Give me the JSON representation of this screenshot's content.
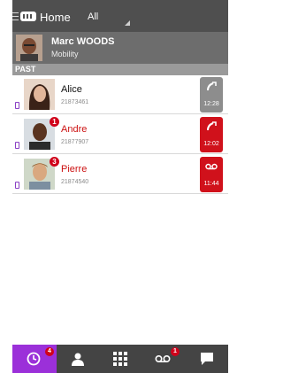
{
  "header": {
    "title": "Home",
    "filter": "All"
  },
  "profile": {
    "name": "Marc WOODS",
    "status": "Mobility"
  },
  "section": {
    "label": "PAST"
  },
  "calls": [
    {
      "name": "Alice",
      "number": "21873461",
      "time": "12:28",
      "missed": false,
      "badge": "",
      "type": "outgoing-call"
    },
    {
      "name": "Andre",
      "number": "21877907",
      "time": "12:02",
      "missed": true,
      "badge": "1",
      "type": "missed-call"
    },
    {
      "name": "Pierre",
      "number": "21874540",
      "time": "11:44",
      "missed": true,
      "badge": "3",
      "type": "voicemail"
    }
  ],
  "nav": {
    "history_badge": "4",
    "voicemail_badge": "1"
  },
  "colors": {
    "accent": "#9b30d9",
    "missed": "#d0111b",
    "topbar": "#4f4f4f"
  }
}
